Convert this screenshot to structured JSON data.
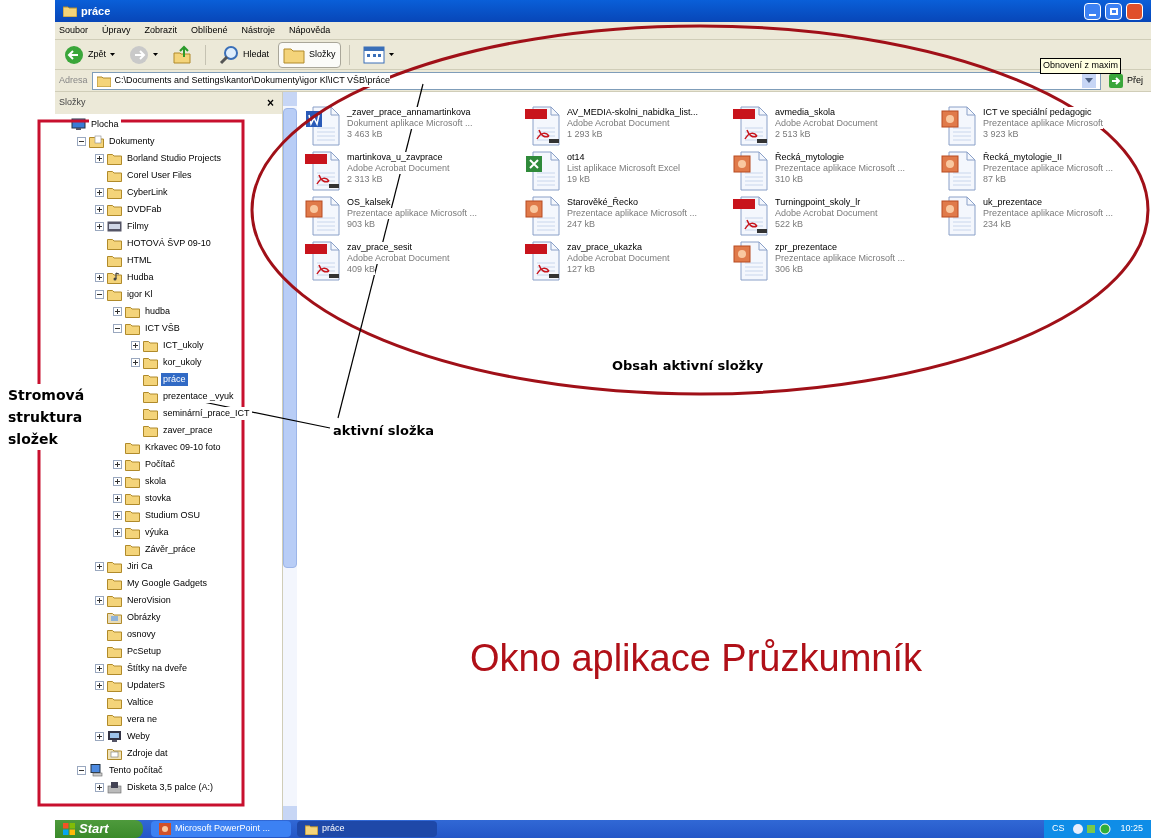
{
  "window": {
    "title": "práce",
    "menu": [
      "Soubor",
      "Úpravy",
      "Zobrazit",
      "Oblíbené",
      "Nástroje",
      "Nápověda"
    ],
    "toolbar": [
      {
        "kind": "back",
        "label": "Zpět",
        "pressed": false
      },
      {
        "kind": "forward",
        "pressed": false
      },
      {
        "kind": "up",
        "pressed": false
      },
      {
        "kind": "search",
        "label": "Hledat",
        "pressed": false
      },
      {
        "kind": "folders",
        "label": "Složky",
        "pressed": true
      },
      {
        "kind": "views",
        "pressed": false
      }
    ],
    "tooltip": "Obnovení z maxim",
    "address": {
      "label": "Adresa",
      "path": "C:\\Documents and Settings\\kantor\\Dokumenty\\igor Kl\\ICT VŠB\\práce",
      "go": "Přej"
    },
    "folders_panel": {
      "title": "Složky",
      "close": "×",
      "tree": [
        {
          "kind": "desktop",
          "label": "Plocha",
          "selected": false,
          "children": [
            {
              "kind": "documents",
              "label": "Dokumenty",
              "selected": false,
              "expanded": true,
              "children": [
                {
                  "kind": "folder",
                  "label": "Borland Studio Projects",
                  "selected": false,
                  "expanded": false
                },
                {
                  "kind": "folder",
                  "label": "Corel User Files",
                  "selected": false
                },
                {
                  "kind": "folder",
                  "label": "CyberLink",
                  "selected": false,
                  "expanded": false
                },
                {
                  "kind": "folder",
                  "label": "DVDFab",
                  "selected": false,
                  "expanded": false
                },
                {
                  "kind": "video",
                  "label": "Filmy",
                  "selected": false,
                  "expanded": false
                },
                {
                  "kind": "folder",
                  "label": "HOTOVÁ ŠVP 09-10",
                  "selected": false
                },
                {
                  "kind": "folder",
                  "label": "HTML",
                  "selected": false
                },
                {
                  "kind": "music",
                  "label": "Hudba",
                  "selected": false,
                  "expanded": false
                },
                {
                  "kind": "folder",
                  "label": "igor Kl",
                  "selected": false,
                  "expanded": true,
                  "children": [
                    {
                      "kind": "folder",
                      "label": "hudba",
                      "selected": false,
                      "expanded": false
                    },
                    {
                      "kind": "folder",
                      "label": "ICT VŠB",
                      "selected": false,
                      "expanded": true,
                      "children": [
                        {
                          "kind": "folder",
                          "label": "ICT_ukoly",
                          "selected": false,
                          "expanded": false
                        },
                        {
                          "kind": "folder",
                          "label": "kor_ukoly",
                          "selected": false,
                          "expanded": false
                        },
                        {
                          "kind": "folder",
                          "label": "práce",
                          "selected": true
                        },
                        {
                          "kind": "folder",
                          "label": "prezentace _vyuk",
                          "selected": false
                        },
                        {
                          "kind": "folder",
                          "label": "seminární_prace_ICT",
                          "selected": false
                        },
                        {
                          "kind": "folder",
                          "label": "zaver_prace",
                          "selected": false
                        }
                      ]
                    },
                    {
                      "kind": "folder",
                      "label": "Krkavec 09-10 foto",
                      "selected": false
                    },
                    {
                      "kind": "folder",
                      "label": "Počítač",
                      "selected": false,
                      "expanded": false
                    },
                    {
                      "kind": "folder",
                      "label": "skola",
                      "selected": false,
                      "expanded": false
                    },
                    {
                      "kind": "folder",
                      "label": "stovka",
                      "selected": false,
                      "expanded": false
                    },
                    {
                      "kind": "folder",
                      "label": "Studium OSU",
                      "selected": false,
                      "expanded": false
                    },
                    {
                      "kind": "folder",
                      "label": "výuka",
                      "selected": false,
                      "expanded": false
                    },
                    {
                      "kind": "folder",
                      "label": "Závěr_práce",
                      "selected": false
                    }
                  ]
                },
                {
                  "kind": "folder",
                  "label": "Jiri Ca",
                  "selected": false,
                  "expanded": false
                },
                {
                  "kind": "folder",
                  "label": "My Google Gadgets",
                  "selected": false
                },
                {
                  "kind": "folder",
                  "label": "NeroVision",
                  "selected": false,
                  "expanded": false
                },
                {
                  "kind": "pictures",
                  "label": "Obrázky",
                  "selected": false
                },
                {
                  "kind": "folder",
                  "label": "osnovy",
                  "selected": false
                },
                {
                  "kind": "folder",
                  "label": "PcSetup",
                  "selected": false
                },
                {
                  "kind": "folder",
                  "label": "Štítky na dveře",
                  "selected": false,
                  "expanded": false
                },
                {
                  "kind": "folder",
                  "label": "UpdaterS",
                  "selected": false,
                  "expanded": false
                },
                {
                  "kind": "folder",
                  "label": "Valtice",
                  "selected": false
                },
                {
                  "kind": "folder",
                  "label": "vera ne",
                  "selected": false
                },
                {
                  "kind": "web",
                  "label": "Weby",
                  "selected": false,
                  "expanded": false
                },
                {
                  "kind": "data",
                  "label": "Zdroje dat",
                  "selected": false
                }
              ]
            },
            {
              "kind": "computer",
              "label": "Tento počítač",
              "selected": false,
              "expanded": true,
              "children": [
                {
                  "kind": "floppy",
                  "label": "Disketa 3,5 palce (A:)",
                  "selected": false,
                  "expanded": false
                }
              ]
            }
          ]
        }
      ]
    },
    "files": [
      {
        "kind": "word",
        "name": "_zaver_prace_annamartinkova",
        "type": "Dokument aplikace Microsoft ...",
        "size": "3 463 kB"
      },
      {
        "kind": "pdf",
        "name": "AV_MEDIA-skolni_nabidka_list...",
        "type": "Adobe Acrobat Document",
        "size": "1 293 kB"
      },
      {
        "kind": "pdf",
        "name": "avmedia_skola",
        "type": "Adobe Acrobat Document",
        "size": "2 513 kB"
      },
      {
        "kind": "ppt",
        "name": "ICT ve speciální pedagogic",
        "type": "Prezentace aplikace Microsoft",
        "size": "3 923 kB"
      },
      {
        "kind": "pdf",
        "name": "martinkova_u_zavprace",
        "type": "Adobe Acrobat Document",
        "size": "2 313 kB"
      },
      {
        "kind": "excel",
        "name": "ot14",
        "type": "List aplikace Microsoft Excel",
        "size": "19 kB"
      },
      {
        "kind": "ppt",
        "name": "Řecká_mytologie",
        "type": "Prezentace aplikace Microsoft ...",
        "size": "310 kB"
      },
      {
        "kind": "ppt",
        "name": "Řecká_mytologie_II",
        "type": "Prezentace aplikace Microsoft ...",
        "size": "87 kB"
      },
      {
        "kind": "ppt",
        "name": "OS_kalsek",
        "type": "Prezentace aplikace Microsoft ...",
        "size": "903 kB"
      },
      {
        "kind": "ppt",
        "name": "Starověké_Řecko",
        "type": "Prezentace aplikace Microsoft ...",
        "size": "247 kB"
      },
      {
        "kind": "pdf",
        "name": "Turningpoint_skoly_lr",
        "type": "Adobe Acrobat Document",
        "size": "522 kB"
      },
      {
        "kind": "ppt",
        "name": "uk_prezentace",
        "type": "Prezentace aplikace Microsoft ...",
        "size": "234 kB"
      },
      {
        "kind": "pdf",
        "name": "zav_prace_sesit",
        "type": "Adobe Acrobat Document",
        "size": "409 kB"
      },
      {
        "kind": "pdf",
        "name": "zav_prace_ukazka",
        "type": "Adobe Acrobat Document",
        "size": "127 kB"
      },
      {
        "kind": "ppt",
        "name": "zpr_prezentace",
        "type": "Prezentace aplikace Microsoft ...",
        "size": "306 kB"
      }
    ]
  },
  "taskbar": {
    "start": "Start",
    "tasks": [
      {
        "kind": "powerpoint",
        "label": "Microsoft PowerPoint ...",
        "selected": false
      },
      {
        "kind": "folder",
        "label": "práce",
        "selected": true
      }
    ],
    "language": "CS",
    "clock": "10:25"
  },
  "annotations": {
    "tree_label": "Stromová struktura složek",
    "selected_label": "aktivní složka",
    "content_label": "Obsah aktivní složky",
    "caption": "Okno aplikace Průzkumník"
  }
}
